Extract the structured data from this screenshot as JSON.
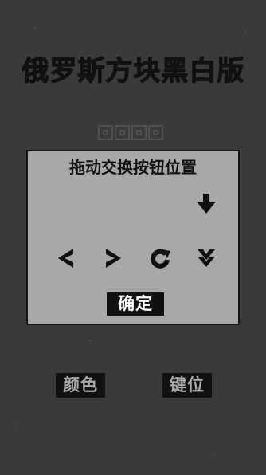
{
  "app": {
    "title": "俄罗斯方块黑白版"
  },
  "dialog": {
    "title": "拖动交换按钮位置",
    "confirm_label": "确定"
  },
  "menu": {
    "color_label": "颜色",
    "keys_label": "键位"
  },
  "icons": {
    "drop": "down-arrow-icon",
    "left": "left-chevron-icon",
    "right": "right-chevron-icon",
    "rotate": "rotate-icon",
    "soft_drop": "double-chevron-down-icon"
  },
  "colors": {
    "background": "#3a3a3a",
    "panel": "#a8a8a8",
    "button": "#111111",
    "button_text_light": "#ffffff",
    "button_text_muted": "#aaaaaa"
  }
}
